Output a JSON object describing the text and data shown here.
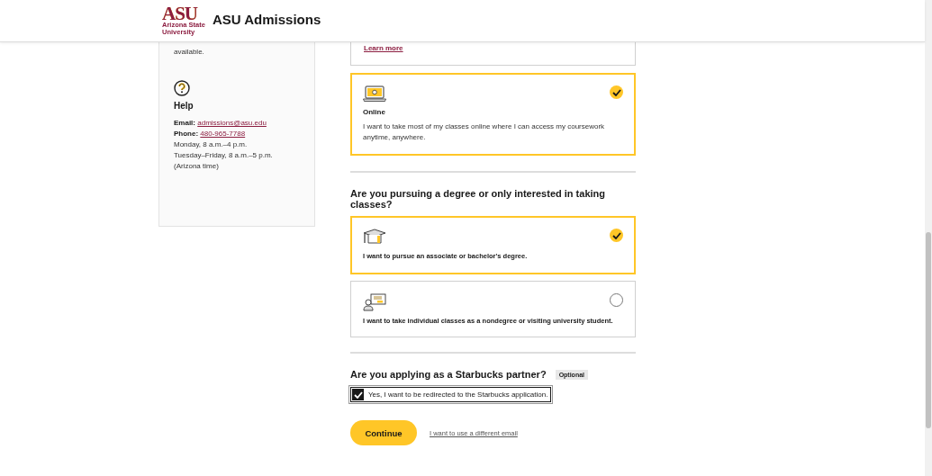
{
  "header": {
    "logo_mark": "ASU",
    "logo_lines": [
      "Arizona State",
      "University"
    ],
    "title": "ASU Admissions"
  },
  "sidebar": {
    "intro_tail": "available.",
    "help": {
      "title": "Help",
      "email_label": "Email:",
      "email": "admissions@asu.edu",
      "phone_label": "Phone:",
      "phone": "480-965-7788",
      "hours": [
        "Monday, 8 a.m.–4 p.m.",
        "Tuesday–Friday, 8 a.m.–5 p.m.",
        "(Arizona time)"
      ]
    }
  },
  "previous_card": {
    "link": "Learn more"
  },
  "format_options": [
    {
      "kind": "laptop",
      "title": "Online",
      "description": "I want to take most of my classes online where I can access my coursework anytime, anywhere.",
      "selected": true
    }
  ],
  "degree": {
    "question": "Are you pursuing a degree or only interested in taking classes?",
    "options": [
      {
        "kind": "cap",
        "text": "I want to pursue an associate or bachelor's degree.",
        "selected": true
      },
      {
        "kind": "classes",
        "text": "I want to take individual classes as a nondegree or visiting university student.",
        "selected": false
      }
    ]
  },
  "starbucks": {
    "question": "Are you applying as a Starbucks partner?",
    "badge": "Optional",
    "checkbox": {
      "label": "Yes, I want to be redirected to the Starbucks application.",
      "checked": true
    }
  },
  "actions": {
    "primary": "Continue",
    "link": "I want to use a different email"
  }
}
